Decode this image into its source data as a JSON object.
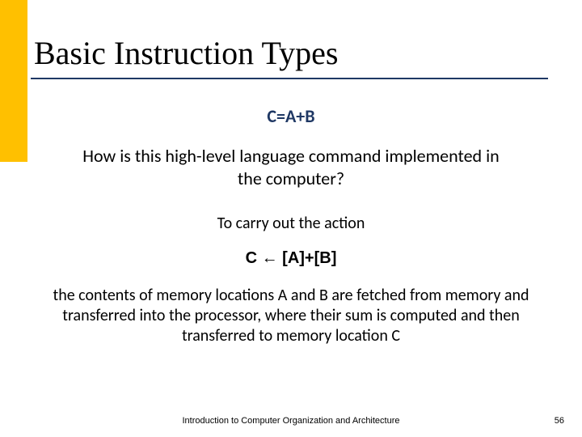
{
  "slide": {
    "title": "Basic Instruction Types",
    "formula_main": "C=A+B",
    "question": "How is this high-level language command implemented in the computer?",
    "action_label": "To carry out the action",
    "formula_arrow": "C ← [A]+[B]",
    "description": "the contents of memory locations A and B are fetched from memory and transferred into the processor, where their sum is computed and then transferred to memory location C",
    "footer": "Introduction to Computer Organization and Architecture",
    "page_number": "56"
  }
}
